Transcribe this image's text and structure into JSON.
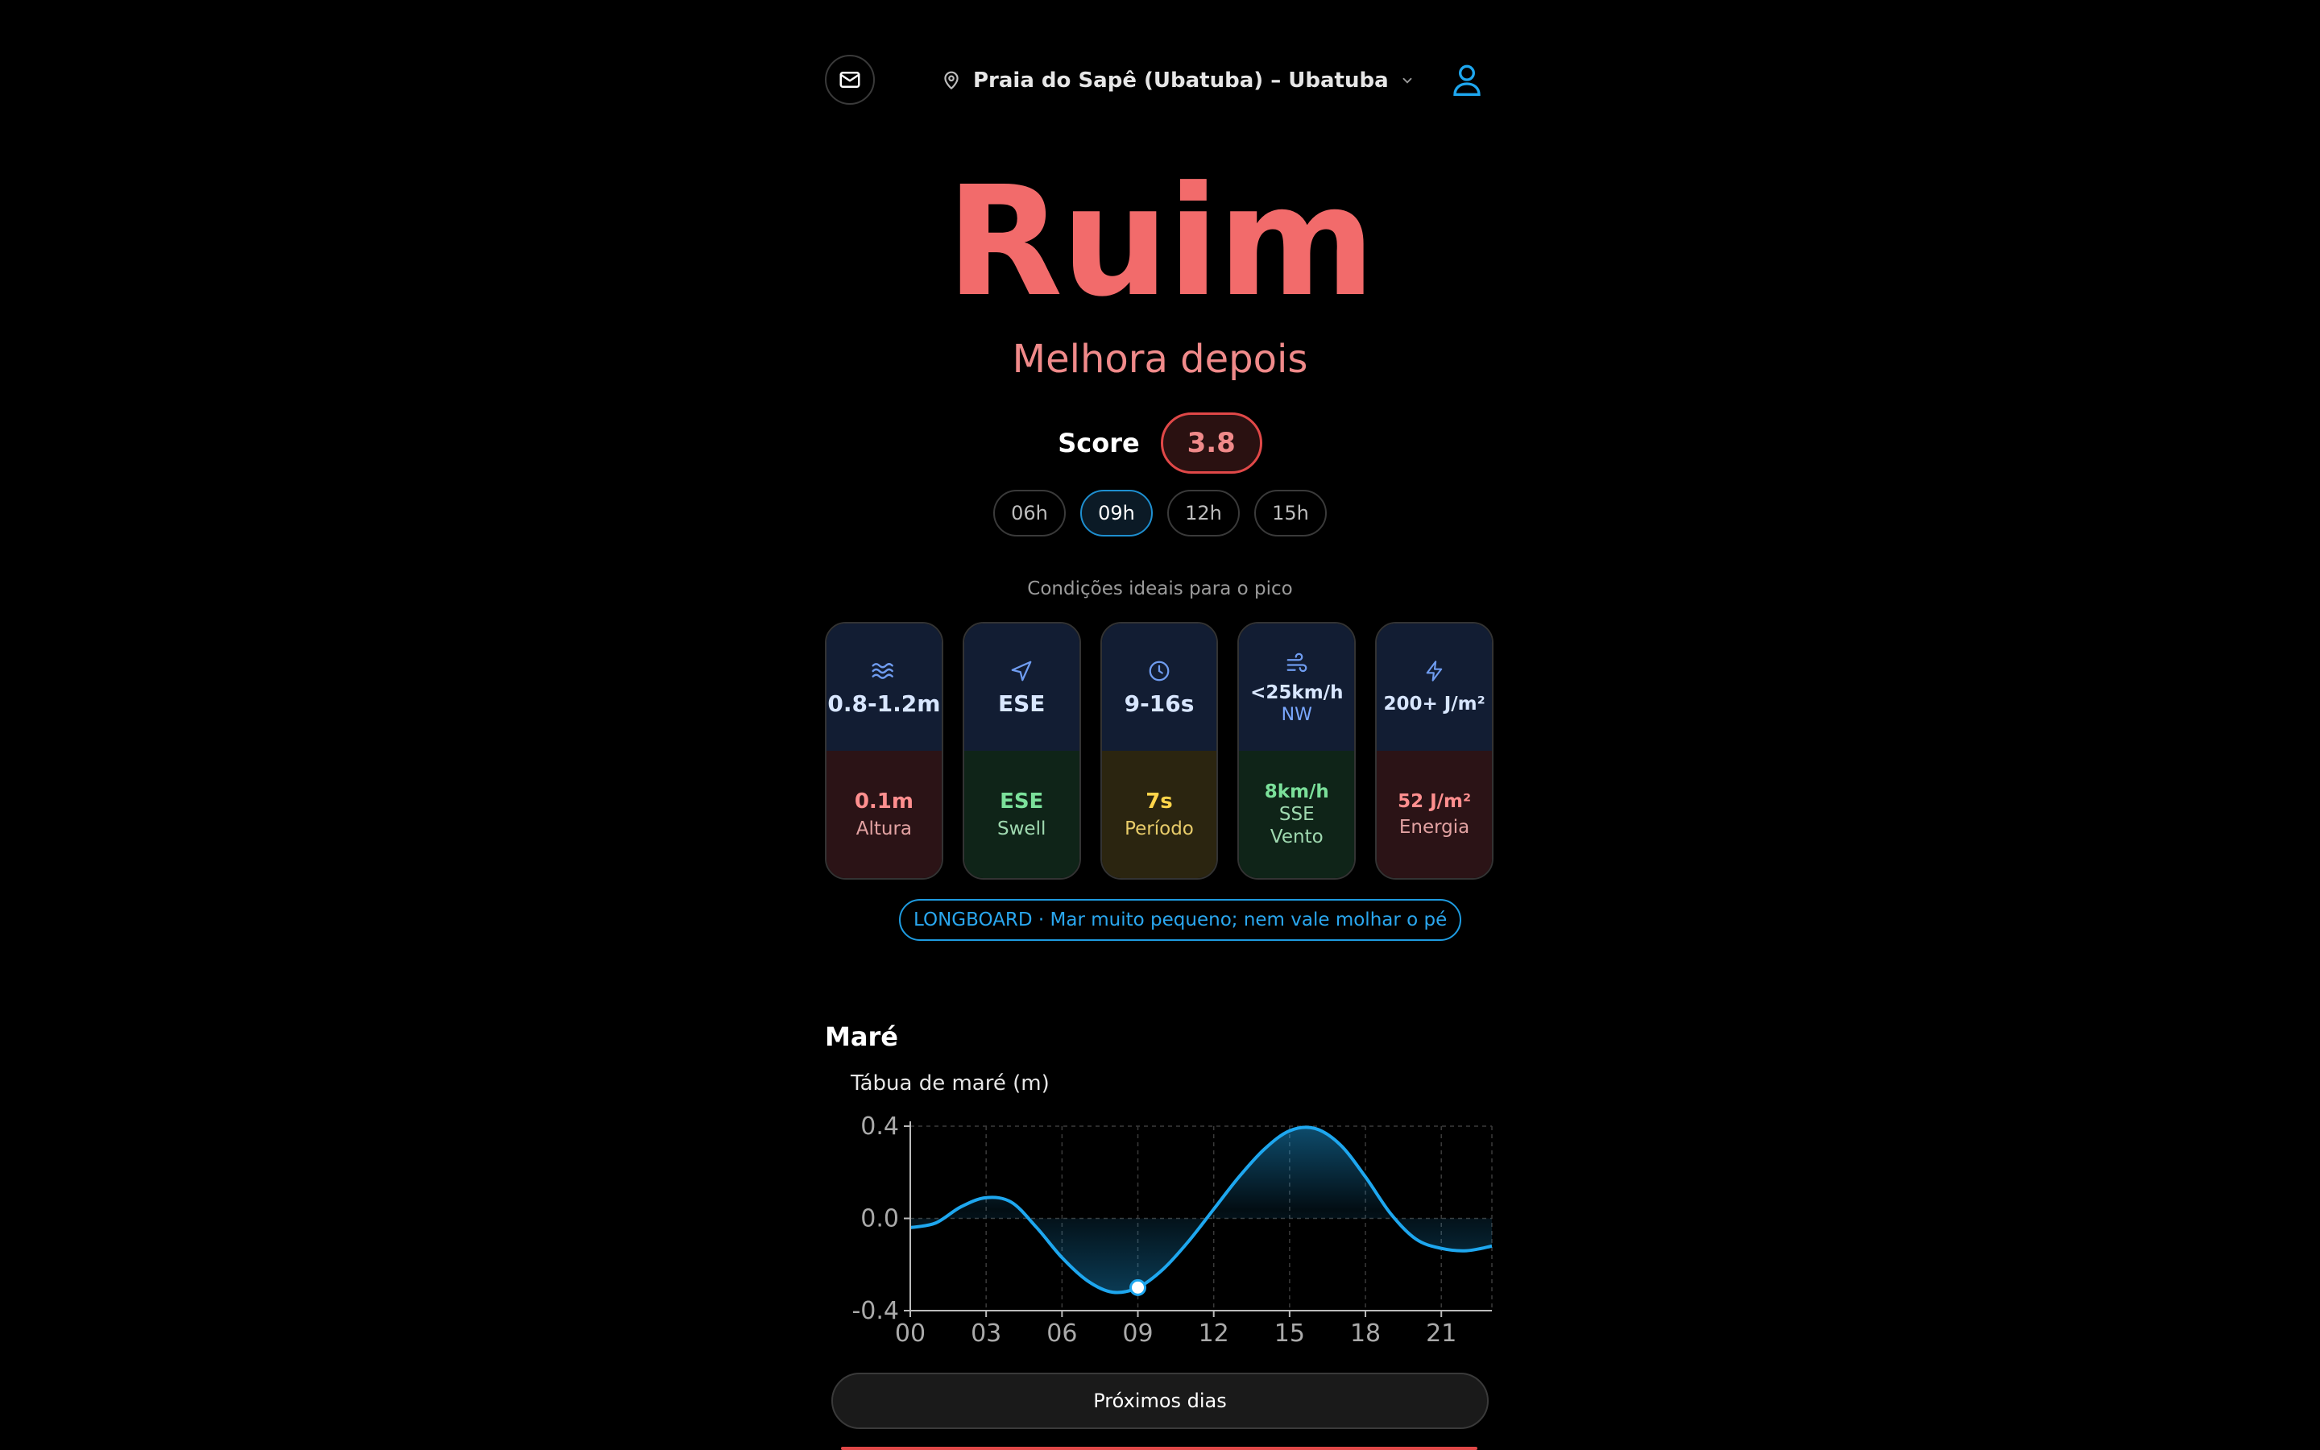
{
  "header": {
    "location": "Praia do Sapê (Ubatuba) – Ubatuba",
    "mail_icon": "mail-icon",
    "pin_icon": "map-pin-icon",
    "chevron_icon": "chevron-down-icon",
    "user_icon": "user-icon"
  },
  "rating": {
    "label": "Ruim",
    "subtitle": "Melhora depois",
    "score_label": "Score",
    "score": "3.8",
    "color": "#f26b6b"
  },
  "hours": [
    {
      "label": "06h",
      "active": false
    },
    {
      "label": "09h",
      "active": true
    },
    {
      "label": "12h",
      "active": false
    },
    {
      "label": "15h",
      "active": false
    }
  ],
  "ideal_note": "Condições ideais para o pico",
  "cards": [
    {
      "icon": "waves-icon",
      "ideal": "0.8-1.2m",
      "ideal2": "",
      "value": "0.1m",
      "value2": "",
      "label": "Altura",
      "status": "bad"
    },
    {
      "icon": "navigation-icon",
      "ideal": "ESE",
      "ideal2": "",
      "value": "ESE",
      "value2": "",
      "label": "Swell",
      "status": "good"
    },
    {
      "icon": "clock-icon",
      "ideal": "9-16s",
      "ideal2": "",
      "value": "7s",
      "value2": "",
      "label": "Período",
      "status": "mid"
    },
    {
      "icon": "wind-icon",
      "ideal": "<25km/h",
      "ideal2": "NW",
      "value": "8km/h",
      "value2": "SSE",
      "label": "Vento",
      "status": "good"
    },
    {
      "icon": "zap-icon",
      "ideal": "200+ J/m²",
      "ideal2": "",
      "value": "52 J/m²",
      "value2": "",
      "label": "Energia",
      "status": "bad"
    }
  ],
  "tag": "LONGBOARD · Mar muito pequeno; nem vale molhar o pé",
  "tide": {
    "section_title": "Maré",
    "chart_title": "Tábua de maré (m)"
  },
  "chart_data": {
    "type": "area",
    "title": "Tábua de maré (m)",
    "x": [
      0,
      1,
      2,
      3,
      4,
      5,
      6,
      7,
      8,
      9,
      10,
      11,
      12,
      13,
      14,
      15,
      16,
      17,
      18,
      19,
      20,
      21,
      22,
      23
    ],
    "y": [
      -0.04,
      -0.02,
      0.05,
      0.09,
      0.07,
      -0.04,
      -0.17,
      -0.27,
      -0.32,
      -0.3,
      -0.22,
      -0.1,
      0.04,
      0.18,
      0.3,
      0.38,
      0.39,
      0.32,
      0.18,
      0.02,
      -0.09,
      -0.13,
      -0.14,
      -0.12
    ],
    "xticks": [
      "00",
      "03",
      "06",
      "09",
      "12",
      "15",
      "18",
      "21"
    ],
    "xtick_values": [
      0,
      3,
      6,
      9,
      12,
      15,
      18,
      21
    ],
    "yticks": [
      "0.4",
      "0.0",
      "-0.4"
    ],
    "ytick_values": [
      0.4,
      0.0,
      -0.4
    ],
    "xlim": [
      0,
      23
    ],
    "ylim": [
      -0.4,
      0.4
    ],
    "marker_x": 9,
    "grid": true,
    "line_color": "#1ea7ef"
  },
  "next_days_label": "Próximos dias"
}
